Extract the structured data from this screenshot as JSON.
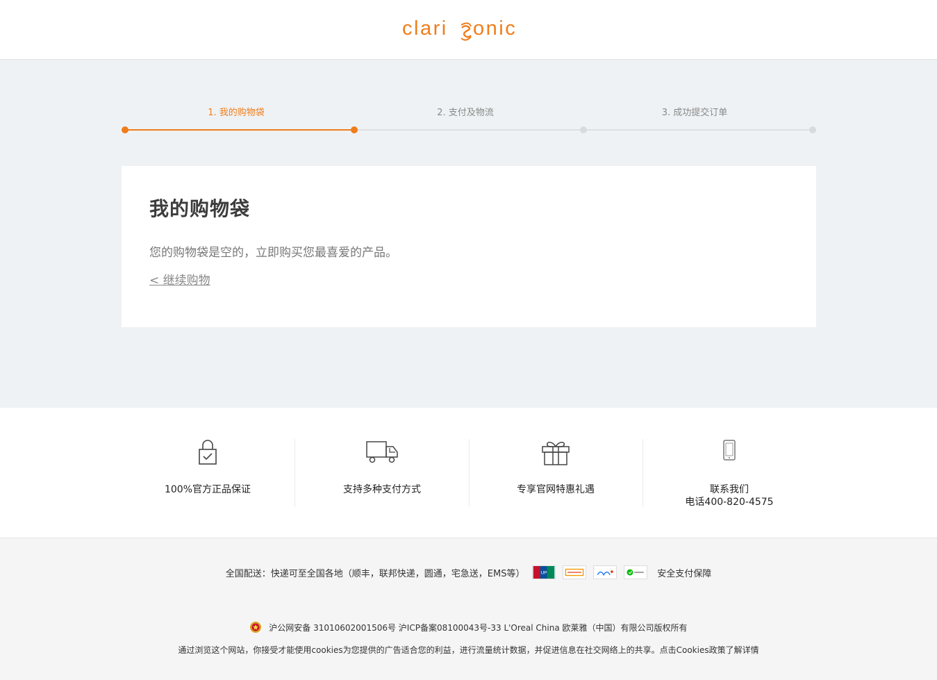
{
  "brand": {
    "logo_text": "clarisonic",
    "accent_color": "#ef7d1a"
  },
  "steps": [
    {
      "label": "1. 我的购物袋",
      "active": true
    },
    {
      "label": "2. 支付及物流",
      "active": false
    },
    {
      "label": "3. 成功提交订单",
      "active": false
    }
  ],
  "cart": {
    "title": "我的购物袋",
    "empty_message": "您的购物袋是空的，立即购买您最喜爱的产品。",
    "continue_link": "< 继续购物"
  },
  "features": [
    {
      "icon": "lock-check-icon",
      "text": "100%官方正品保证"
    },
    {
      "icon": "truck-icon",
      "text": "支持多种支付方式"
    },
    {
      "icon": "gift-icon",
      "text": "专享官网特惠礼遇"
    },
    {
      "icon": "phone-icon",
      "text": "联系我们",
      "subtext": "电话400-820-4575"
    }
  ],
  "footer": {
    "shipping": "全国配送：快递可至全国各地（顺丰，联邦快递，圆通，宅急送，EMS等）",
    "payment_methods": [
      {
        "icon": "unionpay-icon",
        "color": "#c8102e"
      },
      {
        "icon": "bank-transfer-icon",
        "color": "#f39800"
      },
      {
        "icon": "alipay-icon",
        "color": "#1677ff"
      },
      {
        "icon": "wechat-pay-icon",
        "color": "#09bb07"
      }
    ],
    "safe_payment": "安全支付保障",
    "legal": "沪公网安备 31010602001506号  沪ICP备案08100043号-33  L'Oreal China 欧莱雅（中国）有限公司版权所有",
    "cookie_notice": "通过浏览这个网站，你接受才能使用cookies为您提供的广告适合您的利益，进行流量统计数据，并促进信息在社交网络上的共享。点击Cookies政策了解详情"
  }
}
